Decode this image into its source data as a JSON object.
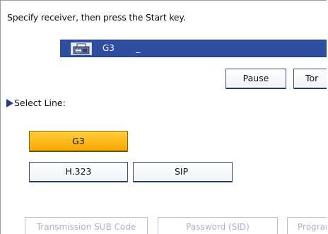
{
  "prompt": "Specify receiver, then press the Start key.",
  "destination": {
    "icon": "fax-machine-icon",
    "line": "G3",
    "cursor": "_",
    "bar_color": "#2f4e9f"
  },
  "buttons": {
    "pause": "Pause",
    "tone": "Tor"
  },
  "select_line": {
    "label": "Select Line:",
    "options": [
      "G3",
      "H.323",
      "SIP"
    ],
    "selected": "G3",
    "selected_color": "#f7b300"
  },
  "bottom_buttons": {
    "transmission_sub_code": "Transmission SUB Code",
    "password_sid": "Password (SID)",
    "program": "Program"
  }
}
